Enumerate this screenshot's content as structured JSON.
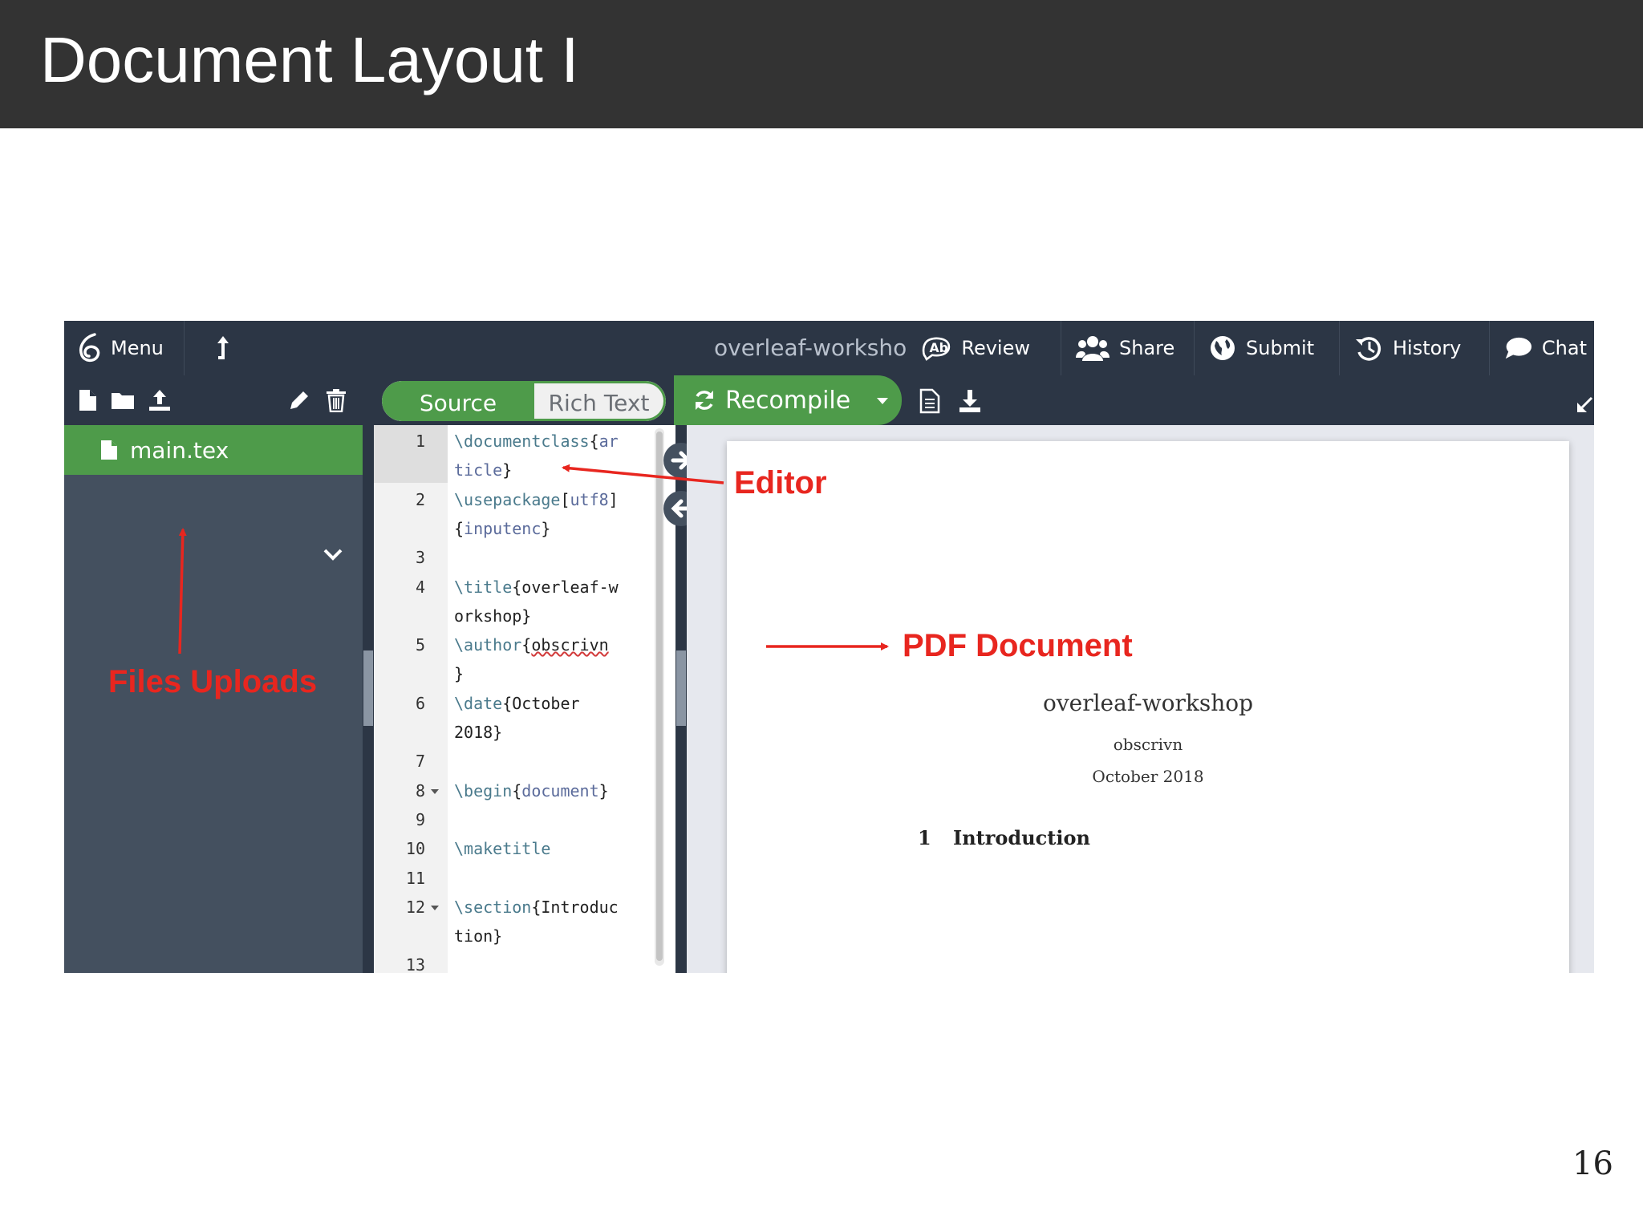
{
  "slide": {
    "title": "Document Layout I",
    "page_number": "16"
  },
  "toolbar": {
    "menu_label": "Menu",
    "project_name": "overleaf-workshop",
    "review_label": "Review",
    "share_label": "Share",
    "submit_label": "Submit",
    "history_label": "History",
    "chat_label": "Chat",
    "icons": [
      "overleaf-logo-icon",
      "upload-arrow-icon",
      "review-icon",
      "users-icon",
      "globe-icon",
      "history-icon",
      "chat-bubble-icon"
    ]
  },
  "file_tools": {
    "icons": [
      "new-file-icon",
      "new-folder-icon",
      "upload-icon",
      "rename-pencil-icon",
      "delete-trash-icon"
    ]
  },
  "editor_mode": {
    "source_label": "Source",
    "rich_text_label": "Rich Text",
    "active": "Source"
  },
  "recompile": {
    "label": "Recompile"
  },
  "file_tree": {
    "selected_file": "main.tex"
  },
  "editor": {
    "lines": [
      {
        "num": "1",
        "parts": [
          {
            "t": "\\documentclass",
            "c": "kw"
          },
          {
            "t": "{",
            "c": ""
          },
          {
            "t": "ar",
            "c": "arg"
          }
        ],
        "wrap": [
          {
            "t": "ticle",
            "c": "arg"
          },
          {
            "t": "}",
            "c": ""
          }
        ]
      },
      {
        "num": "2",
        "parts": [
          {
            "t": "\\usepackage",
            "c": "kw"
          },
          {
            "t": "[",
            "c": ""
          },
          {
            "t": "utf8",
            "c": "arg"
          },
          {
            "t": "]",
            "c": ""
          }
        ],
        "wrap": [
          {
            "t": "{",
            "c": ""
          },
          {
            "t": "inputenc",
            "c": "arg"
          },
          {
            "t": "}",
            "c": ""
          }
        ]
      },
      {
        "num": "3",
        "parts": [],
        "wrap": null
      },
      {
        "num": "4",
        "parts": [
          {
            "t": "\\title",
            "c": "kw"
          },
          {
            "t": "{overleaf-w",
            "c": ""
          }
        ],
        "wrap": [
          {
            "t": "orkshop}",
            "c": ""
          }
        ]
      },
      {
        "num": "5",
        "parts": [
          {
            "t": "\\author",
            "c": "kw"
          },
          {
            "t": "{",
            "c": ""
          },
          {
            "t": "obscrivn",
            "c": "squiggle"
          }
        ],
        "wrap": [
          {
            "t": "}",
            "c": ""
          }
        ]
      },
      {
        "num": "6",
        "parts": [
          {
            "t": "\\date",
            "c": "kw"
          },
          {
            "t": "{October",
            "c": ""
          }
        ],
        "wrap": [
          {
            "t": "2018}",
            "c": ""
          }
        ]
      },
      {
        "num": "7",
        "parts": [],
        "wrap": null
      },
      {
        "num": "8",
        "parts": [
          {
            "t": "\\begin",
            "c": "kw"
          },
          {
            "t": "{",
            "c": ""
          },
          {
            "t": "document",
            "c": "arg"
          },
          {
            "t": "}",
            "c": ""
          }
        ],
        "wrap": null,
        "fold": true
      },
      {
        "num": "9",
        "parts": [],
        "wrap": null
      },
      {
        "num": "10",
        "parts": [
          {
            "t": "\\maketitle",
            "c": "kw"
          }
        ],
        "wrap": null
      },
      {
        "num": "11",
        "parts": [],
        "wrap": null
      },
      {
        "num": "12",
        "parts": [
          {
            "t": "\\section",
            "c": "kw"
          },
          {
            "t": "{Introduc",
            "c": ""
          }
        ],
        "wrap": [
          {
            "t": "tion}",
            "c": ""
          }
        ],
        "fold": true
      },
      {
        "num": "13",
        "parts": [],
        "wrap": null
      }
    ]
  },
  "pdf": {
    "title": "overleaf-workshop",
    "author": "obscrivn",
    "date": "October 2018",
    "section_number": "1",
    "section_title": "Introduction"
  },
  "annotations": {
    "editor": "Editor",
    "files_uploads": "Files Uploads",
    "pdf_document": "PDF Document",
    "color": "#e8261f"
  },
  "colors": {
    "header_bg": "#333333",
    "toolbar_bg": "#2c3645",
    "panel_bg": "#44505f",
    "accent_green": "#4e9b4a",
    "pdf_bg": "#e6e8ee"
  }
}
